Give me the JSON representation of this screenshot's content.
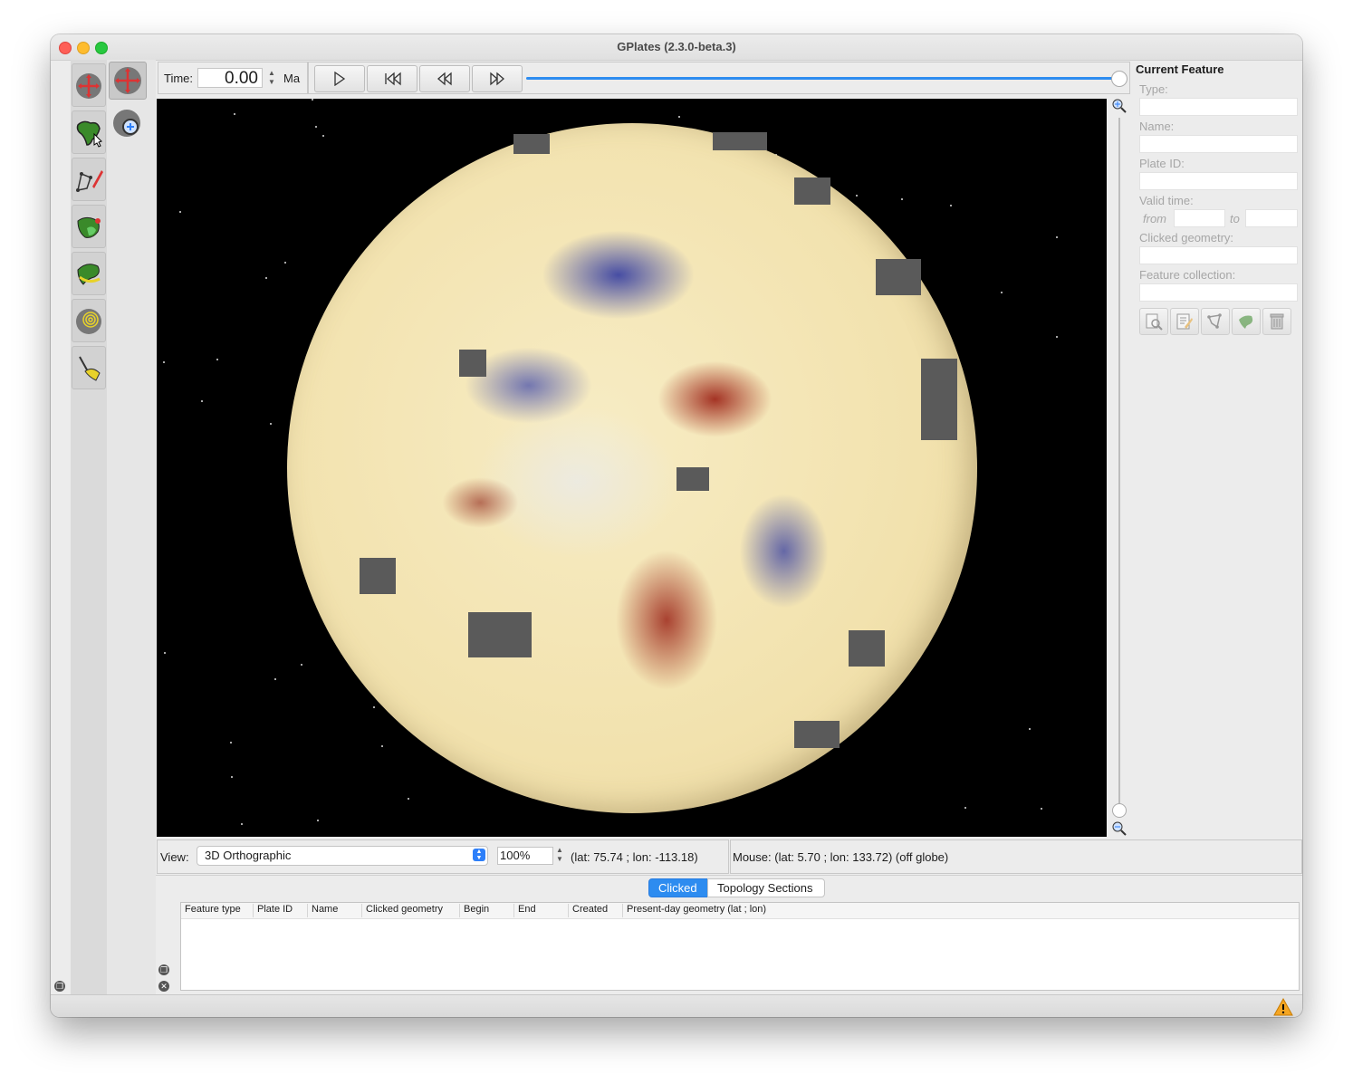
{
  "window": {
    "title": "GPlates (2.3.0-beta.3)"
  },
  "time_control": {
    "label": "Time:",
    "value": "0.00",
    "unit": "Ma"
  },
  "animation": {
    "slider_position_fraction": 1.0
  },
  "view_controls": {
    "label": "View:",
    "projection": "3D Orthographic",
    "zoom": "100%",
    "camera_position": "(lat: 75.74 ; lon: -113.18)"
  },
  "mouse_status": {
    "text": "Mouse: (lat: 5.70 ; lon: 133.72) (off globe)"
  },
  "current_feature": {
    "title": "Current Feature",
    "type_label": "Type:",
    "name_label": "Name:",
    "plate_id_label": "Plate ID:",
    "valid_time_label": "Valid time:",
    "from_label": "from",
    "to_label": "to",
    "clicked_geometry_label": "Clicked geometry:",
    "feature_collection_label": "Feature collection:"
  },
  "bottom_panel": {
    "tabs": [
      "Clicked",
      "Topology Sections"
    ],
    "active_tab": "Clicked",
    "columns": [
      "Feature type",
      "Plate ID",
      "Name",
      "Clicked geometry",
      "Begin",
      "End",
      "Created",
      "Present-day geometry (lat ; lon)"
    ]
  },
  "colors": {
    "accent": "#2d8cf0",
    "canvas_background": "#000000"
  },
  "icons": {
    "tools_left": [
      "drag-globe-icon",
      "choose-feature-icon",
      "digitise-geometry-icon",
      "build-topology-icon",
      "move-vertex-icon",
      "small-circle-icon",
      "measure-distance-icon"
    ],
    "tools_right": [
      "rotate-globe-icon",
      "zoom-globe-icon"
    ],
    "feature_actions": [
      "query-feature-icon",
      "edit-feature-icon",
      "geometry-icon",
      "reconstruct-icon",
      "delete-feature-icon"
    ]
  }
}
